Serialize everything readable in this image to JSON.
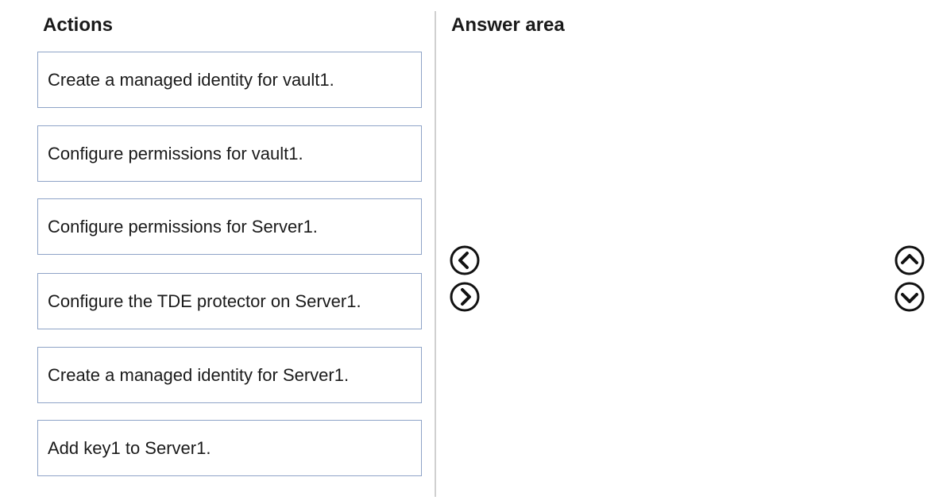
{
  "actions": {
    "heading": "Actions",
    "items": [
      "Create a managed identity for vault1.",
      "Configure permissions for vault1.",
      "Configure permissions for Server1.",
      "Configure the TDE protector on Server1.",
      "Create a managed identity for Server1.",
      "Add key1 to Server1."
    ]
  },
  "answer_area": {
    "heading": "Answer area"
  },
  "controls": {
    "move_left_icon": "chevron-left-circle-icon",
    "move_right_icon": "chevron-right-circle-icon",
    "move_up_icon": "chevron-up-circle-icon",
    "move_down_icon": "chevron-down-circle-icon"
  },
  "colors": {
    "box_border": "#8ea3c7",
    "divider": "#d0d0d0",
    "text": "#1a1a1a"
  }
}
